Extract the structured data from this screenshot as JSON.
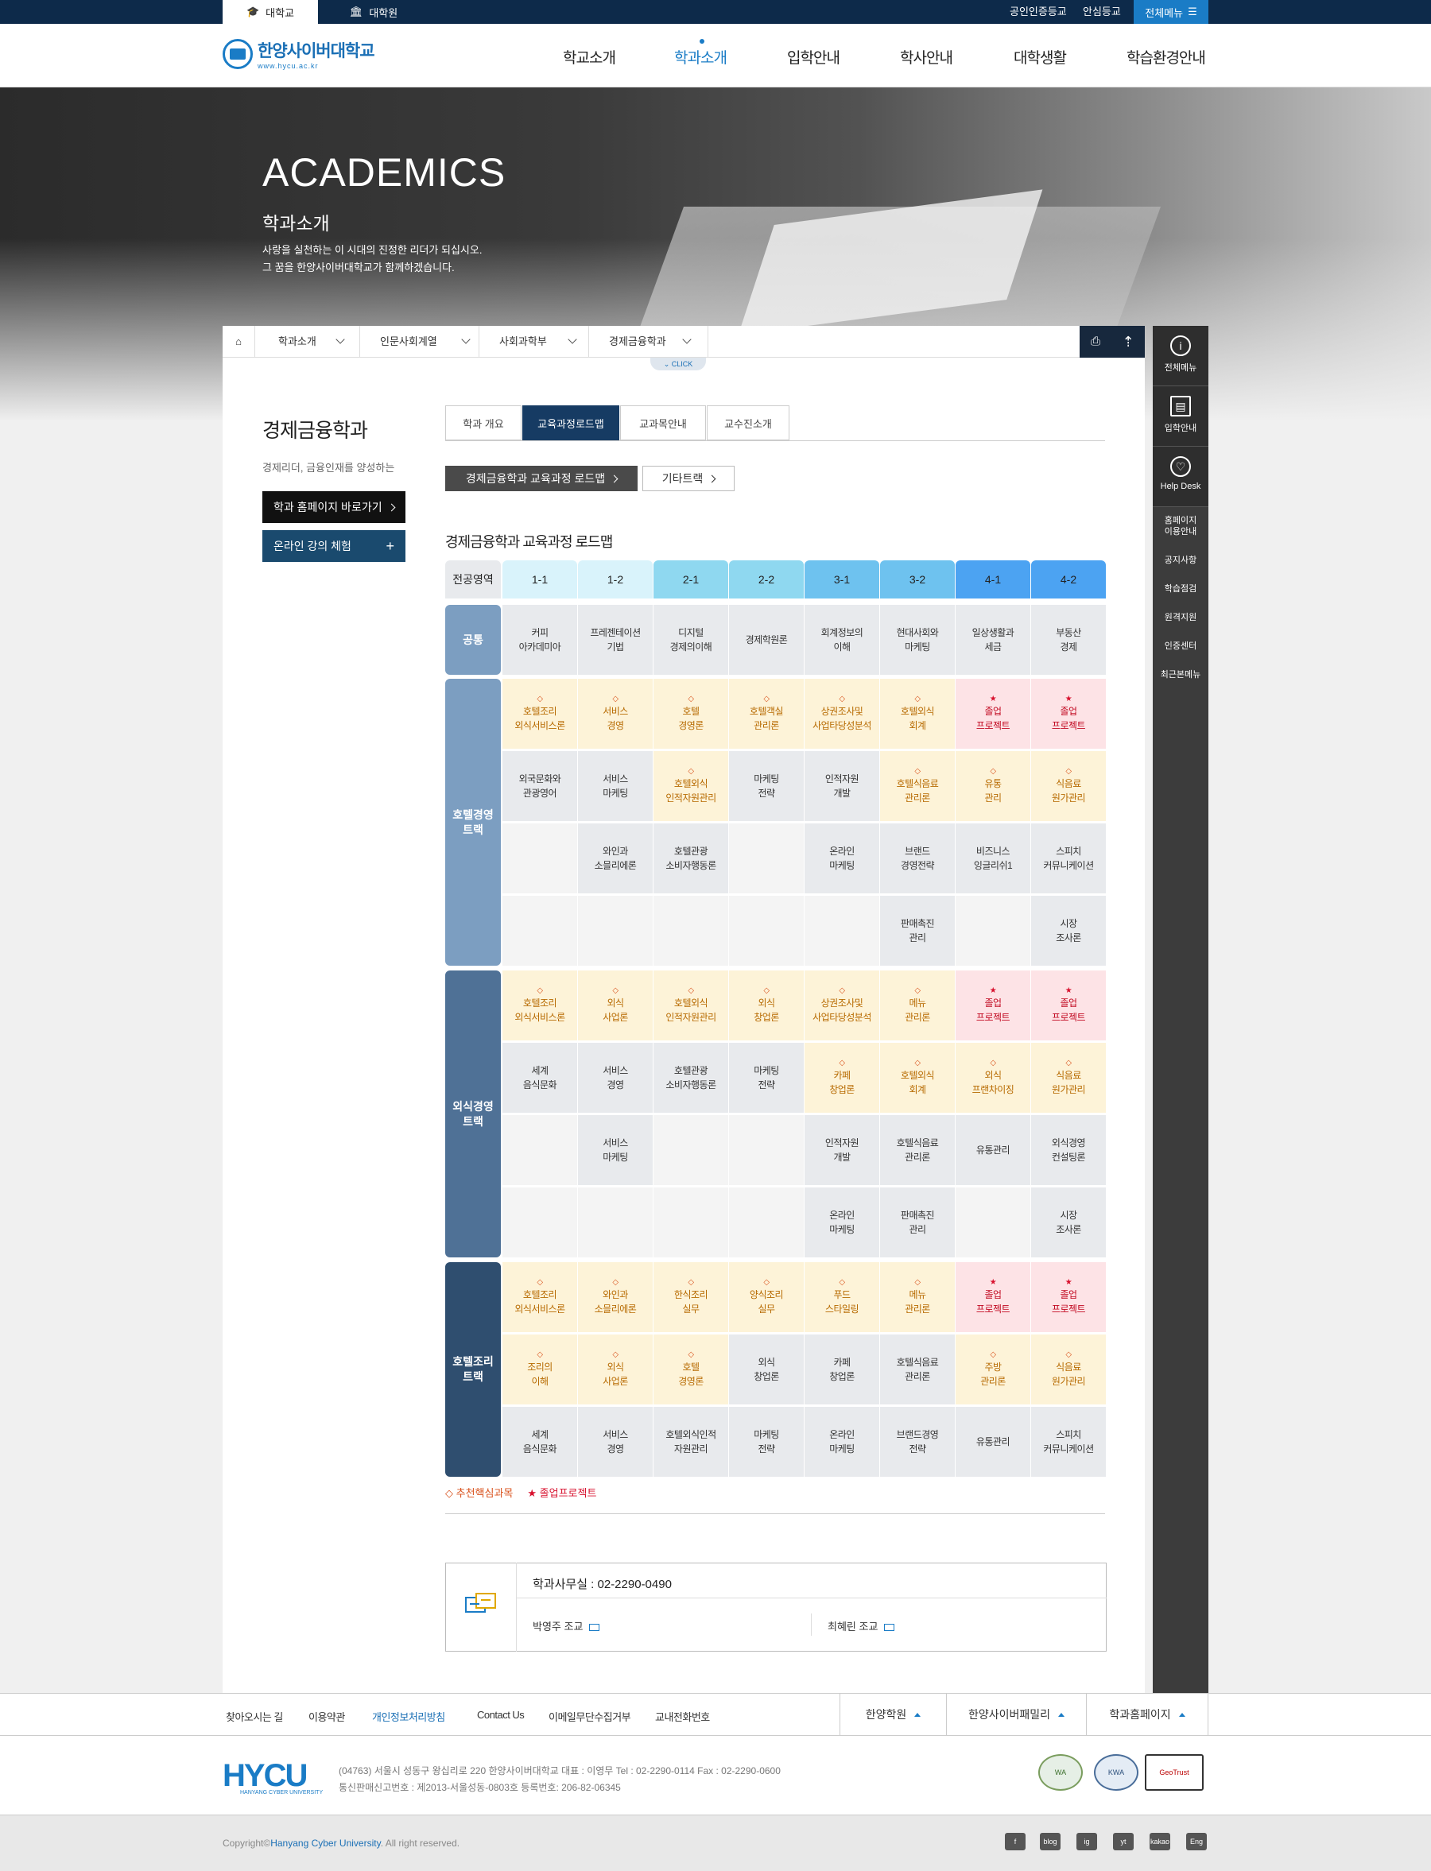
{
  "topbar": {
    "tab_univ": "대학교",
    "tab_grad": "대학원",
    "cert": "공인인증등교",
    "safe": "안심등교",
    "allmenu": "전체메뉴"
  },
  "header": {
    "logo_kr": "한양사이버대학교",
    "logo_url": "www.hycu.ac.kr",
    "nav": [
      "학교소개",
      "학과소개",
      "입학안내",
      "학사안내",
      "대학생활",
      "학습환경안내"
    ]
  },
  "hero": {
    "title": "ACADEMICS",
    "subtitle": "학과소개",
    "desc1": "사랑을 실천하는 이 시대의 진정한 리더가 되십시오.",
    "desc2": "그 꿈을 한양사이버대학교가 함께하겠습니다."
  },
  "breadcrumb": [
    "학과소개",
    "인문사회계열",
    "사회과학부",
    "경제금융학과"
  ],
  "click_label": "CLICK",
  "quick_menu": {
    "big": [
      "전체메뉴",
      "입학안내",
      "Help Desk"
    ],
    "small": [
      "홈페이지\n이용안내",
      "공지사항",
      "학습점검",
      "원격지원",
      "인증센터",
      "최근본메뉴"
    ]
  },
  "left": {
    "dept_title": "경제금융학과",
    "dept_desc": "경제리더, 금융인재를 양성하는",
    "home_btn": "학과 홈페이지 바로가기",
    "online_btn": "온라인 강의 체험"
  },
  "tabs": [
    "학과 개요",
    "교육과정로드맵",
    "교과목안내",
    "교수진소개"
  ],
  "sub_buttons": [
    "경제금융학과 교육과정 로드맵",
    "기타트랙"
  ],
  "roadmap_title": "경제금융학과 교육과정 로드맵",
  "table": {
    "corner": "전공영역",
    "semesters": [
      "1-1",
      "1-2",
      "2-1",
      "2-2",
      "3-1",
      "3-2",
      "4-1",
      "4-2"
    ],
    "common_label": "공통",
    "common": [
      "커피\n아카데미아",
      "프레젠테이션\n기법",
      "디지털\n경제의이해",
      "경제학원론",
      "회계정보의\n이해",
      "현대사회와\n마케팅",
      "일상생활과\n세금",
      "부동산\n경제"
    ],
    "tracks": [
      {
        "label": "호텔경영\n트랙",
        "rows": [
          [
            "R|호텔조리\n외식서비스론",
            "R|서비스\n경영",
            "R|호텔\n경영론",
            "R|호텔객실\n관리론",
            "R|상권조사및\n사업타당성분석",
            "R|호텔외식\n회계",
            "C|졸업\n프로젝트",
            "C|졸업\n프로젝트"
          ],
          [
            "D|외국문화와\n관광영어",
            "D|서비스\n마케팅",
            "R|호텔외식\n인적자원관리",
            "D|마케팅\n전략",
            "D|인적자원\n개발",
            "R|호텔식음료\n관리론",
            "R|유통\n관리",
            "R|식음료\n원가관리"
          ],
          [
            "E|",
            "D|와인과\n소믈리에론",
            "D|호텔관광\n소비자행동론",
            "E|",
            "D|온라인\n마케팅",
            "D|브랜드\n경영전략",
            "D|비즈니스\n잉글리쉬1",
            "D|스피치\n커뮤니케이션"
          ],
          [
            "E|",
            "E|",
            "E|",
            "E|",
            "E|",
            "D|판매촉진\n관리",
            "E|",
            "D|시장\n조사론"
          ]
        ]
      },
      {
        "label": "외식경영\n트랙",
        "rows": [
          [
            "R|호텔조리\n외식서비스론",
            "R|외식\n사업론",
            "R|호텔외식\n인적자원관리",
            "R|외식\n창업론",
            "R|상권조사및\n사업타당성분석",
            "R|메뉴\n관리론",
            "C|졸업\n프로젝트",
            "C|졸업\n프로젝트"
          ],
          [
            "D|세계\n음식문화",
            "D|서비스\n경영",
            "D|호텔관광\n소비자행동론",
            "D|마케팅\n전략",
            "R|카페\n창업론",
            "R|호텔외식\n회계",
            "R|외식\n프랜차이징",
            "R|식음료\n원가관리"
          ],
          [
            "E|",
            "D|서비스\n마케팅",
            "E|",
            "E|",
            "D|인적자원\n개발",
            "D|호텔식음료\n관리론",
            "D|유통관리",
            "D|외식경영\n컨설팅론"
          ],
          [
            "E|",
            "E|",
            "E|",
            "E|",
            "D|온라인\n마케팅",
            "D|판매촉진\n관리",
            "E|",
            "D|시장\n조사론"
          ]
        ]
      },
      {
        "label": "호텔조리\n트랙",
        "rows": [
          [
            "R|호텔조리\n외식서비스론",
            "R|와인과\n소믈리에론",
            "R|한식조리\n실무",
            "R|양식조리\n실무",
            "R|푸드\n스타일링",
            "R|메뉴\n관리론",
            "C|졸업\n프로젝트",
            "C|졸업\n프로젝트"
          ],
          [
            "R|조리의\n이해",
            "R|외식\n사업론",
            "R|호텔\n경영론",
            "D|외식\n창업론",
            "D|카페\n창업론",
            "D|호텔식음료\n관리론",
            "R|주방\n관리론",
            "R|식음료\n원가관리"
          ],
          [
            "D|세계\n음식문화",
            "D|서비스\n경영",
            "D|호텔외식인적\n자원관리",
            "D|마케팅\n전략",
            "D|온라인\n마케팅",
            "D|브랜드경영\n전략",
            "D|유통관리",
            "D|스피치\n커뮤니케이션"
          ]
        ]
      }
    ],
    "legend_rec": "추천핵심과목",
    "legend_cap": "졸업프로젝트"
  },
  "contact": {
    "office": "학과사무실 : 02-2290-0490",
    "person1": "박영주 조교",
    "person2": "최혜린 조교"
  },
  "footer": {
    "links": [
      "찾아오시는 길",
      "이용약관",
      "개인정보처리방침",
      "Contact Us",
      "이메일무단수집거부",
      "교내전화번호"
    ],
    "drops": [
      "한양학원",
      "한양사이버패밀리",
      "학과홈페이지"
    ],
    "logo": "HYCU",
    "logo_sub": "HANYANG CYBER UNIVERSITY",
    "addr1": "(04763) 서울시 성동구 왕십리로 220   한양사이버대학교   대표 : 이영무   Tel : 02-2290-0114   Fax : 02-2290-0600",
    "addr2": "통신판매신고번호 : 제2013-서울성동-0803호   등록번호: 206-82-06345",
    "badges": [
      "WA",
      "KWA",
      "GeoTrust"
    ],
    "copy_pre": "Copyright©",
    "copy_name": "Hanyang Cyber University",
    "copy_post": ". All right reserved.",
    "sns": [
      "f",
      "blog",
      "ig",
      "yt",
      "kakao",
      "Eng"
    ]
  }
}
